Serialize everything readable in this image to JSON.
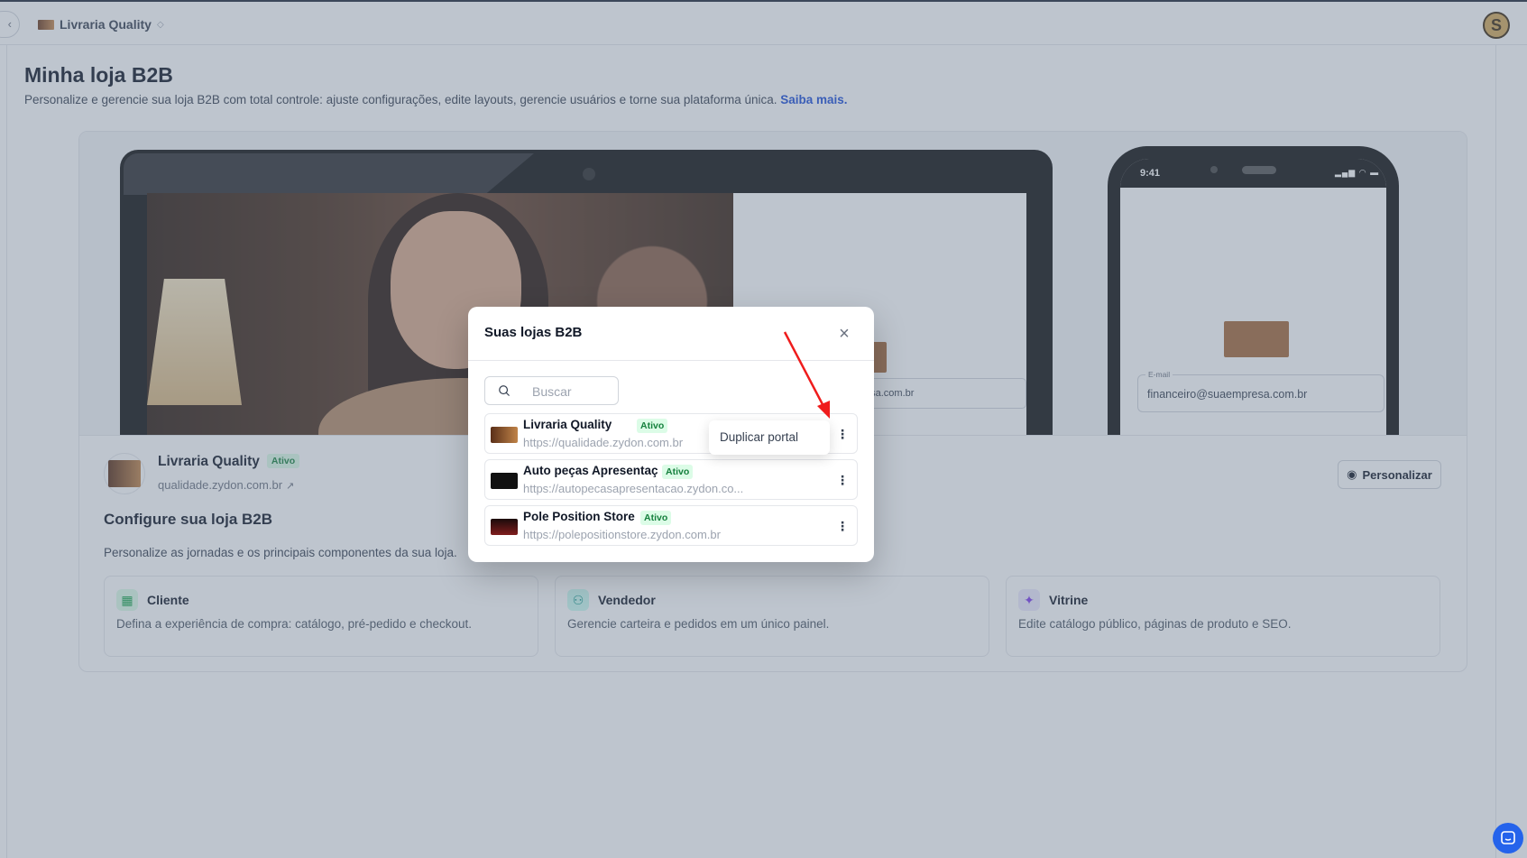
{
  "topbar": {
    "current_store": "Livraria Quality",
    "user_initial": "S"
  },
  "page": {
    "title": "Minha loja B2B",
    "description": "Personalize e gerencie sua loja B2B com total controle: ajuste configurações, edite layouts, gerencie usuários e torne sua plataforma única.",
    "learn_more": "Saiba mais."
  },
  "preview": {
    "laptop_email": "esa.com.br",
    "phone_time": "9:41",
    "phone_field_label": "E-mail",
    "phone_field_value": "financeiro@suaempresa.com.br"
  },
  "store": {
    "name": "Livraria Quality",
    "status": "Ativo",
    "domain": "qualidade.zydon.com.br",
    "customize_label": "Personalizar"
  },
  "configure": {
    "title": "Configure sua loja B2B",
    "description": "Personalize as jornadas e os principais componentes da sua loja."
  },
  "features": [
    {
      "title": "Cliente",
      "description": "Defina a experiência de compra: catálogo, pré-pedido e checkout.",
      "color": "#16a34a",
      "icon": "layout-icon"
    },
    {
      "title": "Vendedor",
      "description": "Gerencie carteira e pedidos em um único painel.",
      "color": "#0d9488",
      "icon": "users-icon"
    },
    {
      "title": "Vitrine",
      "description": "Edite catálogo público, páginas de produto e SEO.",
      "color": "#7c3aed",
      "icon": "sparkle-icon"
    }
  ],
  "modal": {
    "title": "Suas lojas B2B",
    "search_placeholder": "Buscar",
    "stores": [
      {
        "name": "Livraria Quality",
        "status": "Ativo",
        "url": "https://qualidade.zydon.com.br"
      },
      {
        "name": "Auto peças Apresentaç",
        "status": "Ativo",
        "url": "https://autopecasapresentacao.zydon.co..."
      },
      {
        "name": "Pole Position Store",
        "status": "Ativo",
        "url": "https://polepositionstore.zydon.com.br"
      }
    ],
    "tooltip": "Duplicar portal"
  },
  "colors": {
    "accent_link": "#1d4ed8",
    "badge_bg": "#dcfce7",
    "badge_text": "#15803d",
    "arrow": "#ef1c1c",
    "chat": "#2563eb"
  }
}
